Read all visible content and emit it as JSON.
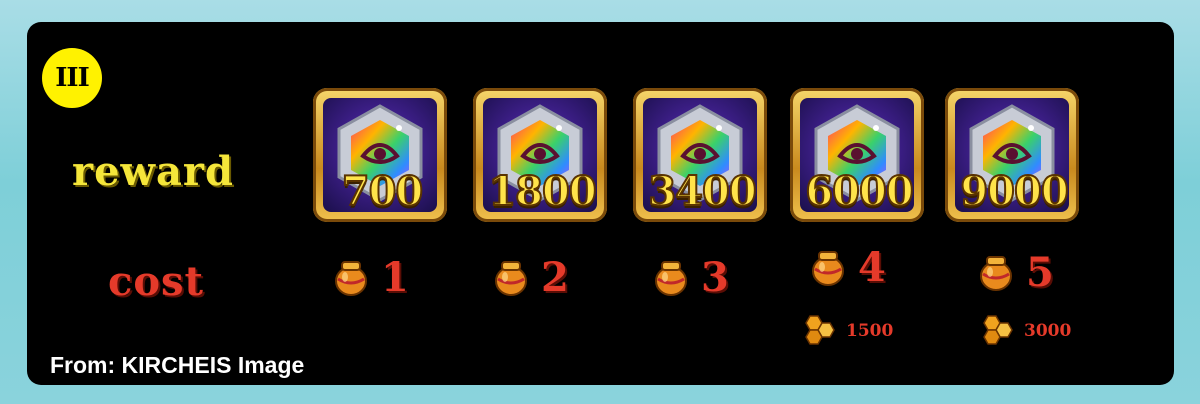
{
  "tier": "III",
  "labels": {
    "reward": "reward",
    "cost": "cost"
  },
  "items": [
    {
      "reward": "700",
      "cost": "1",
      "extra_cost": ""
    },
    {
      "reward": "1800",
      "cost": "2",
      "extra_cost": ""
    },
    {
      "reward": "3400",
      "cost": "3",
      "extra_cost": ""
    },
    {
      "reward": "6000",
      "cost": "4",
      "extra_cost": "1500"
    },
    {
      "reward": "9000",
      "cost": "5",
      "extra_cost": "3000"
    }
  ],
  "icons": {
    "reward": "rainbow-crest-badge-icon",
    "cost": "jar-icon",
    "extra_cost": "honeycomb-icon"
  },
  "colors": {
    "badge": "#fff200",
    "reward_text": "#f5e63a",
    "cost_text": "#e53a2a",
    "frame": "#e0a83a"
  },
  "source": "From: KIRCHEIS Image"
}
